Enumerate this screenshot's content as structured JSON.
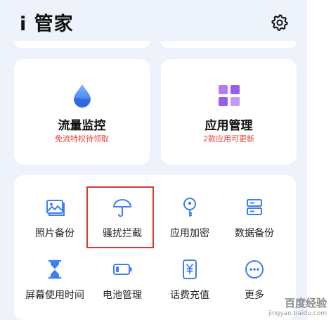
{
  "app": {
    "title": "i 管家"
  },
  "colors": {
    "background": "#eef3fb",
    "card": "#ffffff",
    "accent_blue": "#3d7ff0",
    "accent_purple": "#a563f0",
    "subtitle_red": "#e8453c",
    "highlight_red": "#e0352b"
  },
  "feature_cards": [
    {
      "icon": "water-drop-icon",
      "title": "流量监控",
      "subtitle": "免流特权待领取"
    },
    {
      "icon": "app-grid-icon",
      "title": "应用管理",
      "subtitle": "2款应用可更新"
    }
  ],
  "tools": [
    {
      "icon": "photo-icon",
      "label": "照片备份"
    },
    {
      "icon": "umbrella-icon",
      "label": "骚扰拦截",
      "highlighted": true
    },
    {
      "icon": "key-lock-icon",
      "label": "应用加密"
    },
    {
      "icon": "data-backup-icon",
      "label": "数据备份"
    },
    {
      "icon": "hourglass-icon",
      "label": "屏幕使用时间"
    },
    {
      "icon": "battery-icon",
      "label": "电池管理"
    },
    {
      "icon": "phone-bill-icon",
      "label": "话费充值"
    },
    {
      "icon": "more-icon",
      "label": "更多"
    }
  ],
  "watermark": {
    "text": "百度经验",
    "url": "jingyan.baidu.com"
  }
}
